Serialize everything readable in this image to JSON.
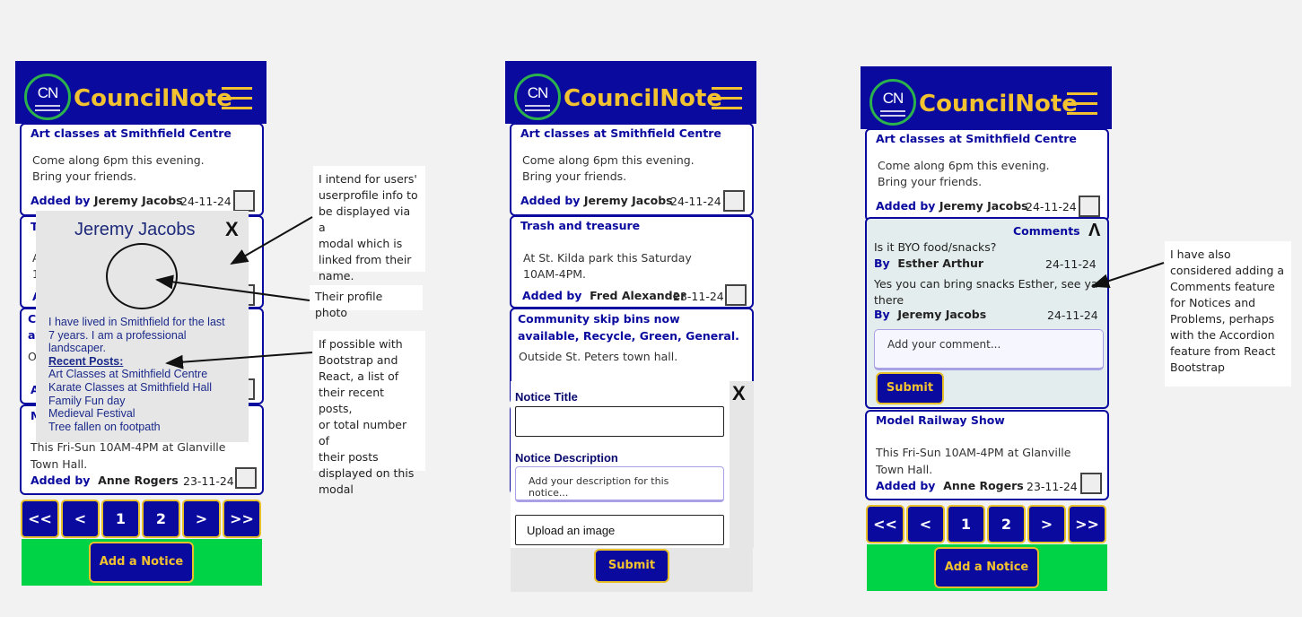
{
  "app": {
    "brand": "CouncilNote",
    "logo_text": "CN",
    "accent": "#0a0a9e",
    "highlight": "#f2c230",
    "green": "#00d446"
  },
  "notices": {
    "art": {
      "title": "Art classes at Smithfield Centre",
      "line1": "Come along 6pm this evening.",
      "line2": "Bring your friends.",
      "added_by": "Added by",
      "author": "Jeremy Jacobs",
      "date": "24-11-24"
    },
    "trash": {
      "title": "Trash and treasure",
      "line1": "At St. Kilda park this Saturday",
      "line2": "10AM-4PM.",
      "added_by": "Added by",
      "author": "Fred Alexander",
      "date": "23-11-24"
    },
    "skip": {
      "title_line1": "Community skip bins now",
      "title_line2": "available, Recycle, Green, General.",
      "line1": "Outside St. Peters town hall."
    },
    "model": {
      "title": "Model Railway Show",
      "line1": "This Fri-Sun 10AM-4PM at Glanville",
      "line2": "Town Hall.",
      "added_by": "Added by",
      "author": "Anne Rogers",
      "date": "23-11-24"
    },
    "partial": {
      "t": "T",
      "a": "A",
      "one": "1",
      "c": "C",
      "av": "av",
      "o": "O",
      "m": "M"
    }
  },
  "pagination": {
    "first": "<<",
    "prev": "<",
    "p1": "1",
    "p2": "2",
    "next": ">",
    "last": ">>"
  },
  "add_notice": "Add a Notice",
  "profile_modal": {
    "close": "X",
    "name": "Jeremy Jacobs",
    "bio1": "I have lived in Smithfield for the last",
    "bio2": "7 years. I am a professional",
    "bio3": "landscaper.",
    "recent_heading": "Recent Posts:",
    "posts": [
      "Art Classes at Smithfield Centre",
      "Karate Classes at Smithfield Hall",
      "Family Fun day",
      "Medieval Festival",
      "Tree fallen on footpath"
    ]
  },
  "notice_modal": {
    "close": "X",
    "title_label": "Notice Title",
    "desc_label": "Notice Description",
    "desc_placeholder": "Add your description for this notice...",
    "upload": "Upload an image",
    "submit": "Submit"
  },
  "comments": {
    "heading": "Comments",
    "collapse": "Λ",
    "q": "Is it BYO food/snacks?",
    "by": "By",
    "author1": "Esther Arthur",
    "date1": "24-11-24",
    "reply1": "Yes you can bring snacks Esther, see ya",
    "reply2": "there",
    "author2": "Jeremy Jacobs",
    "date2": "24-11-24",
    "placeholder": "Add your comment...",
    "submit": "Submit"
  },
  "notes": {
    "profile": [
      "I intend for users'",
      "userprofile info to",
      "be displayed via a",
      " modal which is",
      "linked from their",
      "name."
    ],
    "photo": "Their profile photo",
    "recent": [
      "If possible with",
      "Bootstrap and",
      "React, a list of",
      "their recent posts,",
      "or total number of",
      "their posts",
      "displayed on this",
      "modal"
    ],
    "comments": [
      "I have also",
      "considered adding a",
      "Comments feature",
      "for Notices and",
      "Problems, perhaps",
      "with the Accordion",
      "feature from React",
      "Bootstrap"
    ]
  }
}
